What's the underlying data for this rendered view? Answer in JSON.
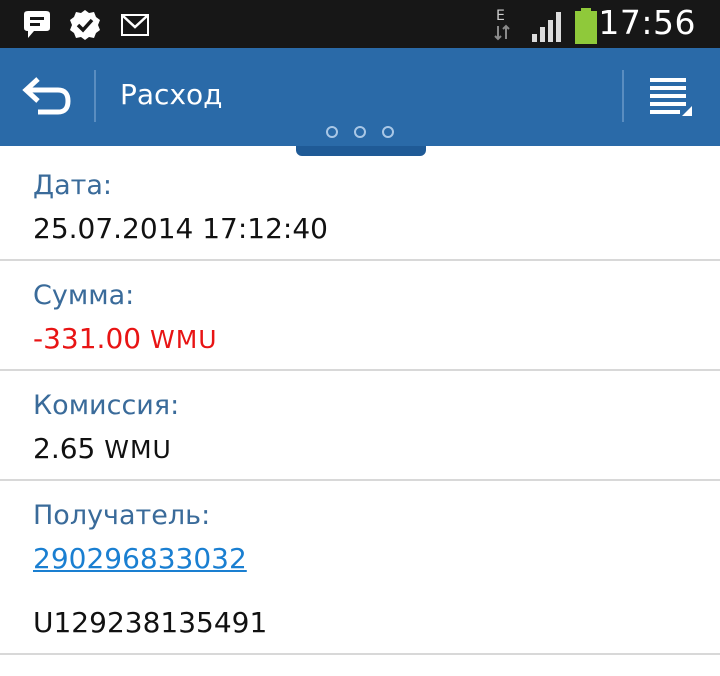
{
  "status_bar": {
    "time": "17:56",
    "network_type": "E",
    "icons": [
      "chat-bubble-icon",
      "check-badge-icon",
      "mail-icon",
      "data-arrows-icon",
      "signal-icon",
      "battery-icon"
    ]
  },
  "action_bar": {
    "title": "Расход",
    "back_icon": "back-arrow-icon",
    "menu_icon": "overflow-menu-icon"
  },
  "colors": {
    "action_bar": "#2a6aa8",
    "label": "#3a6b9a",
    "negative": "#e81414",
    "link": "#1a7fd1"
  },
  "details": {
    "date": {
      "label": "Дата:",
      "value": "25.07.2014 17:12:40"
    },
    "amount": {
      "label": "Сумма:",
      "value": "-331.00",
      "currency": "WMU"
    },
    "commission": {
      "label": "Комиссия:",
      "value": "2.65",
      "currency": "WMU"
    },
    "recipient": {
      "label": "Получатель:",
      "wmid": "290296833032",
      "purse": "U129238135491"
    }
  }
}
